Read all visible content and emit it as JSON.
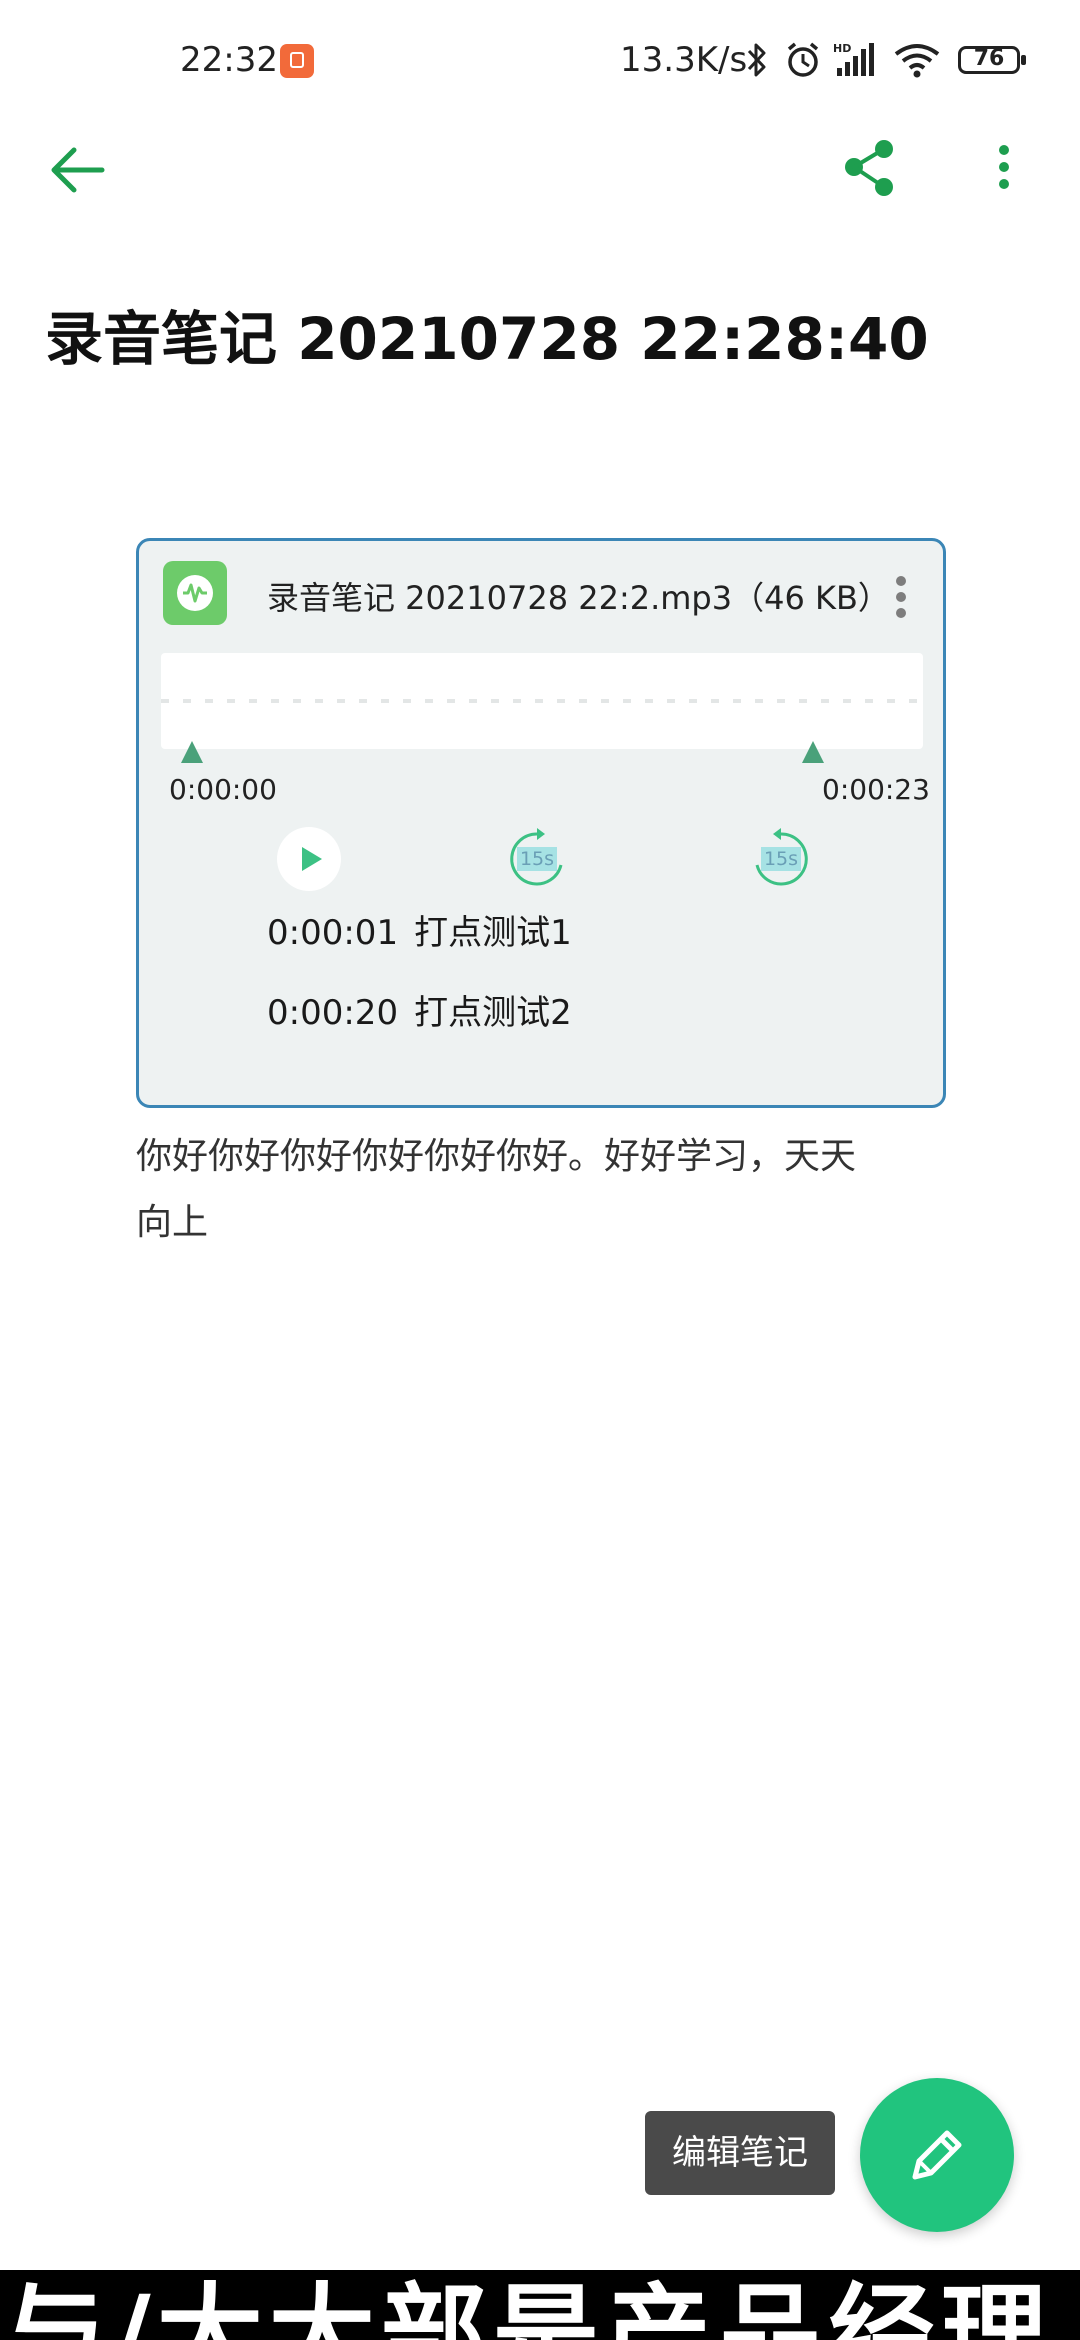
{
  "status_bar": {
    "time": "22:32",
    "network_speed": "13.3K/s",
    "battery_level": "76",
    "icons": [
      "app-notification-icon",
      "bluetooth-icon",
      "alarm-icon",
      "hd-signal-icon",
      "wifi-icon",
      "battery-icon"
    ]
  },
  "toolbar": {
    "back_icon": "arrow-left-icon",
    "share_icon": "share-icon",
    "more_icon": "more-vertical-icon",
    "accent_color": "#1e9e4f"
  },
  "note": {
    "title": "录音笔记 20210728 22:28:40",
    "body_line1": "你好你好你好你好你好你好。好好学习，天天",
    "body_line2": "向上"
  },
  "audio_card": {
    "filename": "录音笔记 20210728 22:2.mp3（46 KB）",
    "time_start": "0:00:00",
    "time_end": "0:00:23",
    "rewind_label": "15s",
    "forward_label": "15s",
    "border_color": "#3b86b6",
    "bookmarks": [
      {
        "time": "0:00:01",
        "label": "打点测试1"
      },
      {
        "time": "0:00:20",
        "label": "打点测试2"
      }
    ]
  },
  "actions": {
    "edit_tooltip": "编辑笔记",
    "fab_icon": "pencil-icon",
    "fab_color": "#21c47e"
  },
  "overlay": {
    "caption": "与/大大部是产品经理"
  }
}
